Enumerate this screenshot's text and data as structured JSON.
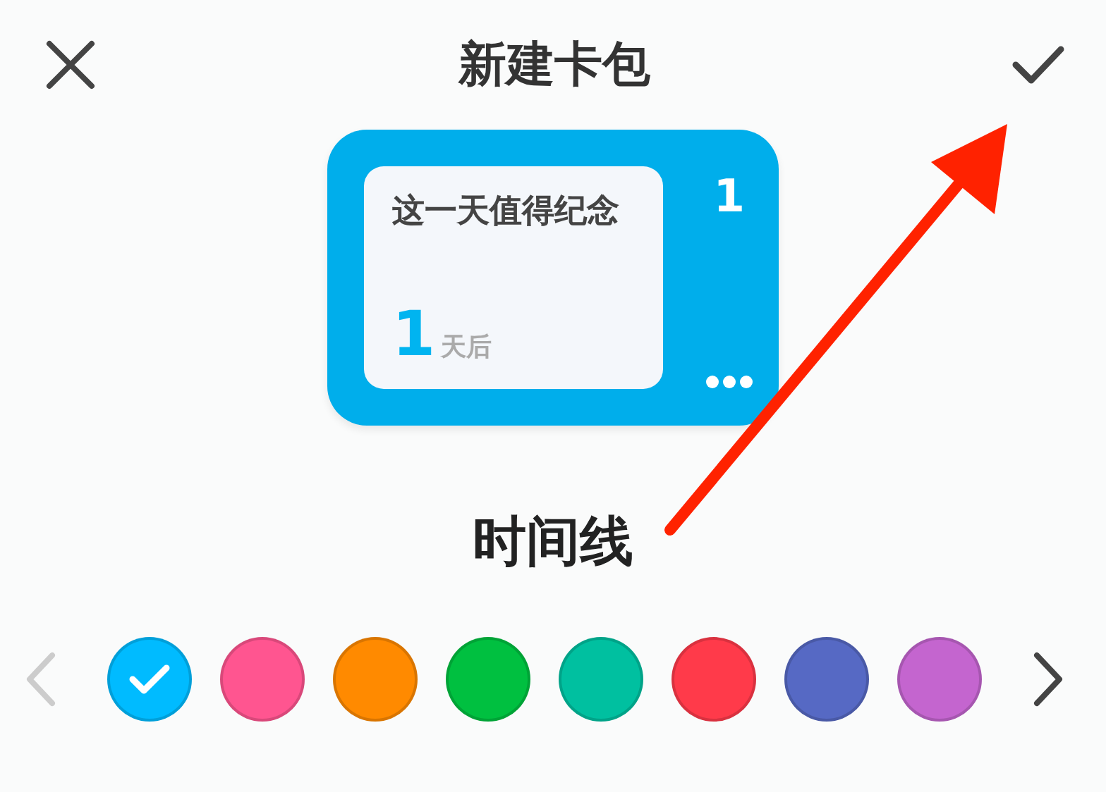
{
  "header": {
    "title": "新建卡包"
  },
  "card_preview": {
    "event_title": "这一天值得纪念",
    "days": "1",
    "days_unit": "天后",
    "count": "1"
  },
  "style_label": "时间线",
  "color_picker": {
    "prev": {
      "disabled": true
    },
    "next": {
      "disabled": false
    },
    "swatches": [
      {
        "color": "#00bbff",
        "selected": true
      },
      {
        "color": "#ff5590",
        "selected": false
      },
      {
        "color": "#ff8a00",
        "selected": false
      },
      {
        "color": "#00c040",
        "selected": false
      },
      {
        "color": "#00c0a0",
        "selected": false
      },
      {
        "color": "#ff3a4a",
        "selected": false
      },
      {
        "color": "#5669c4",
        "selected": false
      },
      {
        "color": "#c465cf",
        "selected": false
      }
    ]
  }
}
